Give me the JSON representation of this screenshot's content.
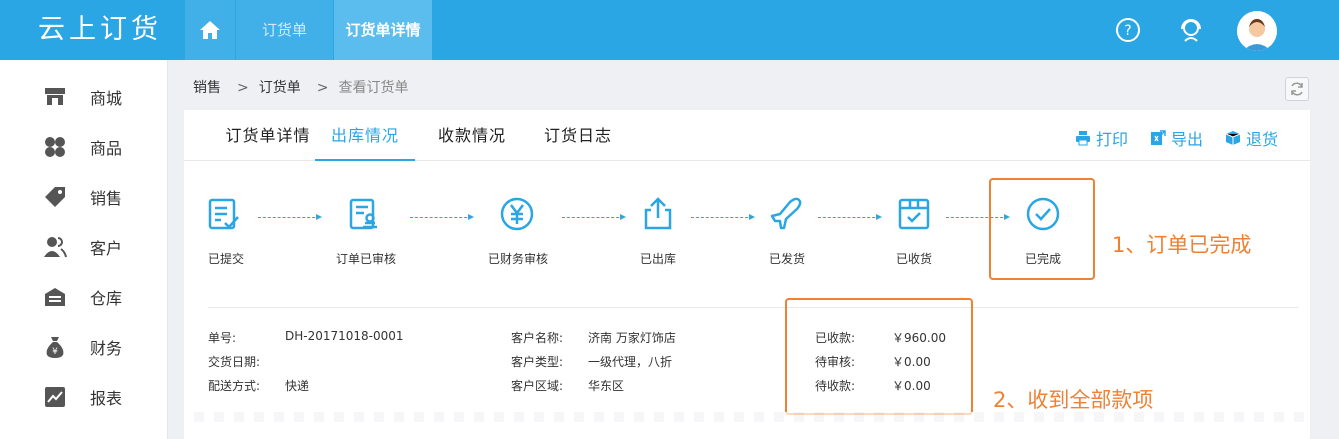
{
  "app": {
    "logo_text": "云上订货"
  },
  "top_tabs": [
    {
      "label": "订货单"
    },
    {
      "label": "订货单详情"
    }
  ],
  "sidebar": {
    "items": [
      {
        "label": "商城",
        "icon": "store-icon"
      },
      {
        "label": "商品",
        "icon": "grid-icon"
      },
      {
        "label": "销售",
        "icon": "tag-icon"
      },
      {
        "label": "客户",
        "icon": "users-icon"
      },
      {
        "label": "仓库",
        "icon": "warehouse-icon"
      },
      {
        "label": "财务",
        "icon": "money-bag-icon"
      },
      {
        "label": "报表",
        "icon": "chart-icon"
      }
    ]
  },
  "breadcrumb": {
    "items": [
      "销售",
      "订货单",
      "查看订货单"
    ],
    "separator": ">"
  },
  "detail_tabs": [
    {
      "label": "订货单详情"
    },
    {
      "label": "出库情况"
    },
    {
      "label": "收款情况"
    },
    {
      "label": "订货日志"
    }
  ],
  "actions": {
    "print": "打印",
    "export": "导出",
    "return": "退货"
  },
  "steps": [
    {
      "label": "已提交"
    },
    {
      "label": "订单已审核"
    },
    {
      "label": "已财务审核"
    },
    {
      "label": "已出库"
    },
    {
      "label": "已发货"
    },
    {
      "label": "已收货"
    },
    {
      "label": "已完成"
    }
  ],
  "annotations": {
    "first": "1、订单已完成",
    "second": "2、收到全部款项"
  },
  "order_info": {
    "order_no_label": "单号:",
    "order_no": "DH-20171018-0001",
    "delivery_date_label": "交货日期:",
    "delivery_date": "",
    "shipping_label": "配送方式:",
    "shipping": "快递",
    "customer_name_label": "客户名称:",
    "customer_name": "济南 万家灯饰店",
    "customer_type_label": "客户类型:",
    "customer_type": "一级代理，八折",
    "customer_region_label": "客户区域:",
    "customer_region": "华东区",
    "received_label": "已收款:",
    "received": "￥960.00",
    "pending_review_label": "待审核:",
    "pending_review": "￥0.00",
    "pending_collect_label": "待收款:",
    "pending_collect": "￥0.00"
  },
  "colors": {
    "primary": "#2aa6e4",
    "highlight": "#f08032"
  }
}
